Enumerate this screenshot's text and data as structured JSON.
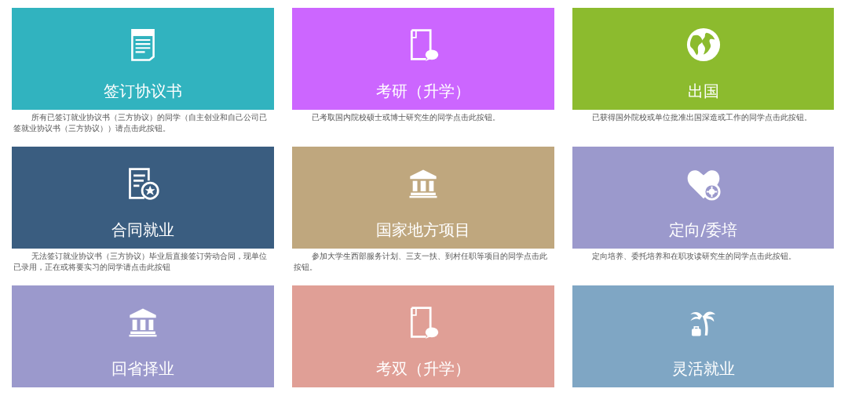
{
  "cards": [
    {
      "title": "签订协议书",
      "kind": "contract",
      "color": "#31b3bf",
      "description": "所有已签订就业协议书（三方协议）的同学（自主创业和自己公司已签就业协议书（三方协议））请点击此按钮。"
    },
    {
      "title": "考研（升学）",
      "kind": "admission",
      "color": "#cc66ff",
      "description": "已考取国内院校硕士或博士研究生的同学点击此按钮。"
    },
    {
      "title": "出国",
      "kind": "globe",
      "color": "#8cbb2e",
      "description": "已获得国外院校或单位批准出国深造或工作的同学点击此按钮。"
    },
    {
      "title": "合同就业",
      "kind": "document-star",
      "color": "#3a5d80",
      "description": "无法签订就业协议书（三方协议）毕业后直接签订劳动合同，现单位已录用，正在或将要实习的同学请点击此按钮"
    },
    {
      "title": "国家地方项目",
      "kind": "building",
      "color": "#bfa77e",
      "description": "参加大学生西部服务计划、三支一扶、到村任职等项目的同学点击此按钮。"
    },
    {
      "title": "定向/委培",
      "kind": "heart-plus",
      "color": "#9b99cc",
      "description": "定向培养、委托培养和在职攻读研究生的同学点击此按钮。"
    },
    {
      "title": "回省择业",
      "kind": "building",
      "color": "#9b99cc"
    },
    {
      "title": "考双（升学）",
      "kind": "admission",
      "color": "#e09f96"
    },
    {
      "title": "灵活就业",
      "kind": "palm",
      "color": "#7fa6c4"
    }
  ]
}
